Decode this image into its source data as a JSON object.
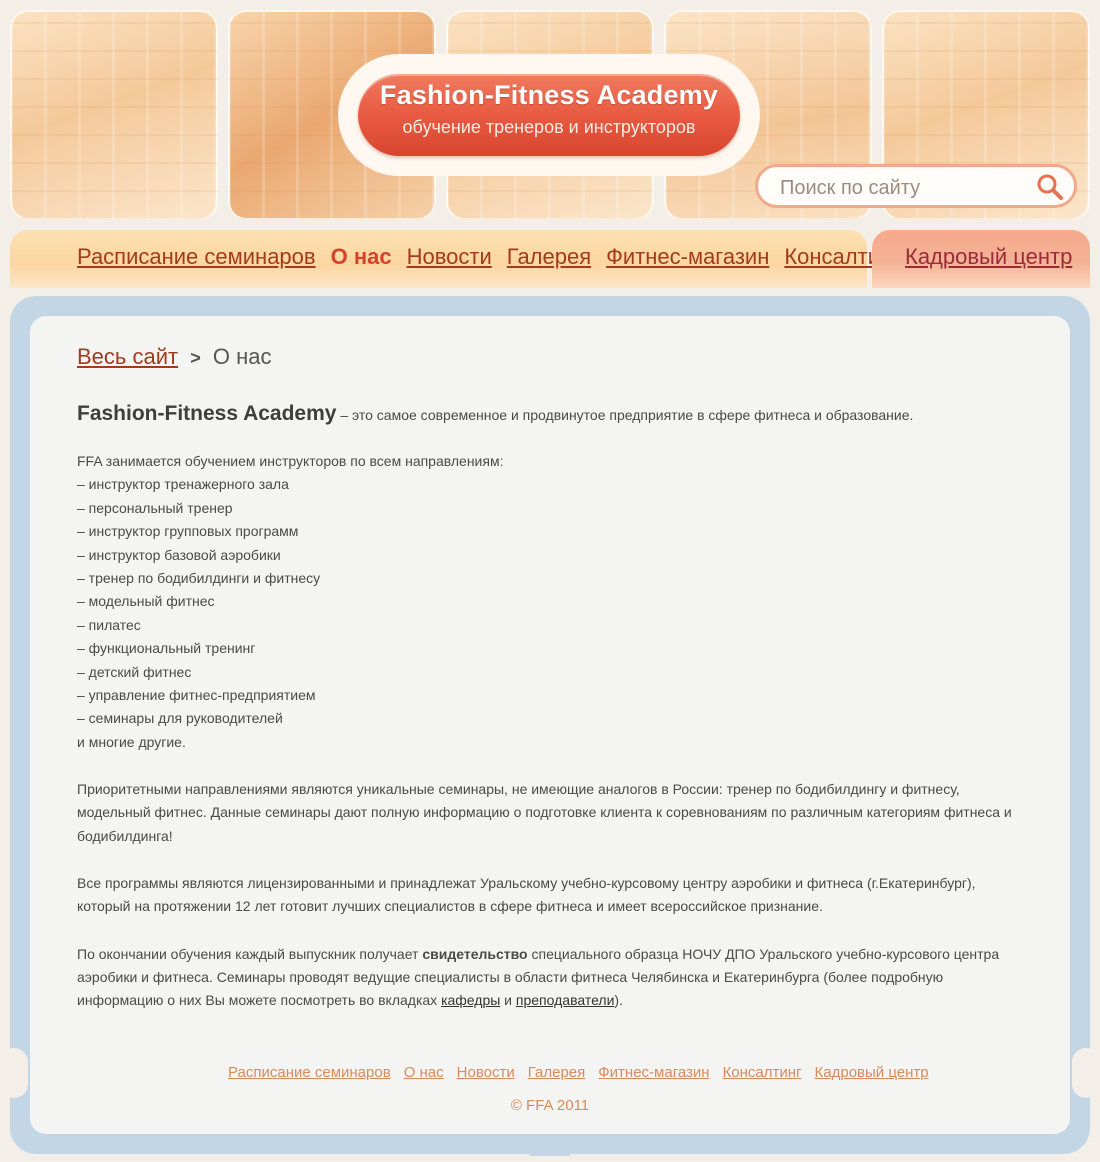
{
  "header": {
    "logo_title": "Fashion-Fitness Academy",
    "logo_subtitle": "обучение тренеров и инструкторов",
    "search_placeholder": "Поиск по сайту",
    "search_icon": "search-icon"
  },
  "nav": {
    "items": [
      {
        "label": "Расписание семинаров",
        "active": false
      },
      {
        "label": "О нас",
        "active": true
      },
      {
        "label": "Новости",
        "active": false
      },
      {
        "label": "Галерея",
        "active": false
      },
      {
        "label": "Фитнес-магазин",
        "active": false
      },
      {
        "label": "Консалтинг",
        "active": false
      }
    ],
    "hr_center": "Кадровый центр"
  },
  "breadcrumb": {
    "root": "Весь сайт",
    "separator": ">",
    "current": "О нас"
  },
  "content": {
    "intro_brand": "Fashion-Fitness Academy",
    "intro_rest": " – это самое современное и продвинутое предприятие в сфере фитнеса и образование.",
    "list_heading": "FFA занимается обучением инструкторов по всем направлениям:",
    "directions": [
      "– инструктор тренажерного зала",
      "– персональный тренер",
      "– инструктор групповых программ",
      "– инструктор базовой аэробики",
      "– тренер по бодибилдинги и фитнесу",
      "– модельный фитнес",
      "– пилатес",
      "– функциональный тренинг",
      "– детский фитнес",
      "– управление фитнес-предприятием",
      "– семинары для руководителей"
    ],
    "list_tail": "и многие другие.",
    "priority": "Приоритетными направлениями являются уникальные семинары, не имеющие аналогов в России: тренер по бодибилдингу и фитнесу, модельный фитнес. Данные семинары дают полную информацию о подготовке клиента к соревнованиям по различным категориям фитнеса и бодибилдинга!",
    "licensing": "Все программы являются лицензированными и принадлежат Уральскому учебно-курсовому центру аэробики и фитнеса (г.Екатеринбург), который на протяжении 12 лет готовит лучших специалистов в сфере фитнеса и имеет всероссийское признание.",
    "graduation_pre": "По окончании обучения каждый выпускник получает ",
    "graduation_bold": "свидетельство",
    "graduation_mid": " специального образца НОЧУ ДПО Уральского учебно-курсового центра аэробики и фитнеса. Семинары проводят ведущие специалисты в области фитнеса Челябинска и Екатеринбурга (более подробную информацию о них Вы можете посмотреть во вкладках ",
    "link_departments": "кафедры",
    "graduation_and": " и ",
    "link_teachers": "преподаватели",
    "graduation_end": ")."
  },
  "footer": {
    "links": [
      "Расписание семинаров",
      "О нас",
      "Новости",
      "Галерея",
      "Фитнес-магазин",
      "Консалтинг",
      "Кадровый центр"
    ],
    "copyright": "© FFA 2011"
  },
  "colors": {
    "accent_red": "#e85a42",
    "nav_link": "#a33a1e",
    "frame_blue": "#c3d6e6",
    "footer_link": "#d88a5a"
  }
}
